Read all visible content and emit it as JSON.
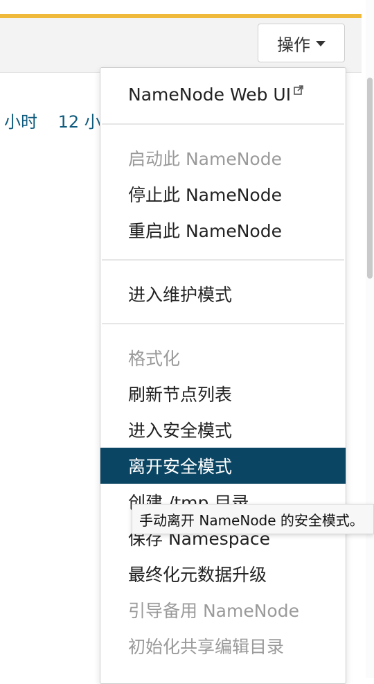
{
  "toolbar": {
    "actions_label": "操作"
  },
  "time_range": {
    "items": [
      "小时",
      "12 小"
    ]
  },
  "menu": {
    "web_ui": "NameNode Web UI",
    "start": "启动此 NameNode",
    "stop": "停止此 NameNode",
    "restart": "重启此 NameNode",
    "maintenance": "进入维护模式",
    "format": "格式化",
    "refresh_nodes": "刷新节点列表",
    "enter_safe": "进入安全模式",
    "leave_safe": "离开安全模式",
    "create_tmp": "创建 /tmp 目录",
    "save_namespace": "保存 Namespace",
    "finalize_metadata": "最终化元数据升级",
    "bootstrap_standby": "引导备用 NameNode",
    "init_shared_edits": "初始化共享编辑目录"
  },
  "tooltip": {
    "text": "手动离开 NameNode 的安全模式。"
  },
  "colors": {
    "accent": "#efb93b",
    "active_bg": "#0a4563",
    "link": "#0e5a7c"
  }
}
